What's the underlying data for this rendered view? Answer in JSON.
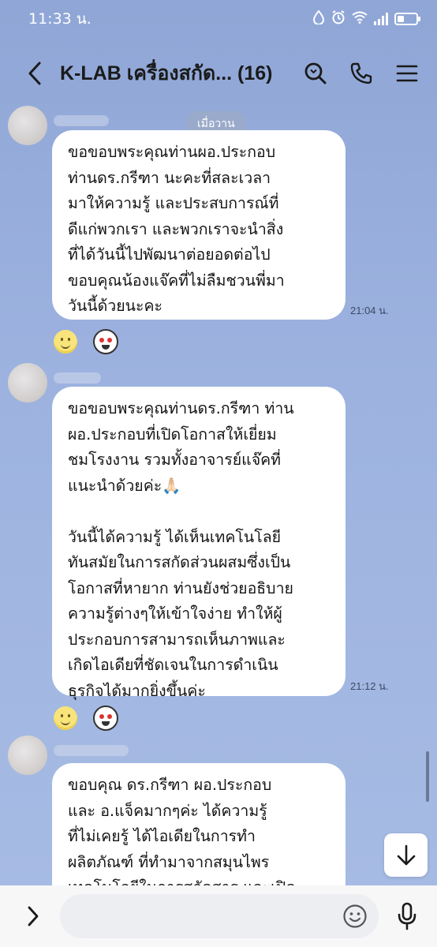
{
  "status_bar": {
    "time": "11:33 น.",
    "icons": [
      "data-saver-icon",
      "alarm-icon",
      "wifi-icon",
      "signal-icon",
      "battery-icon"
    ]
  },
  "header": {
    "title": "K-LAB  เครื่องสกัด... (16)",
    "icons": [
      "back-arrow-icon",
      "search-icon",
      "phone-icon",
      "menu-icon"
    ]
  },
  "date_separator": "เมื่อวาน",
  "messages": [
    {
      "text": "ขอขอบพระคุณท่านผอ.ประกอบ\nท่านดร.กรีฑา นะคะที่สละเวลา\nมาให้ความรู้ และประสบการณ์ที่\nดีแก่พวกเรา และพวกเราจะนำสิ่ง\nที่ได้วันนี้ไปพัฒนาต่อยอดต่อไป\nขอบคุณน้องแจ๊คที่ไม่ลืมชวนพี่มา\nวันนี้ด้วยนะคะ",
      "time": "21:04 น.",
      "reactions": [
        "smile-reaction-icon",
        "sticker-reaction-icon"
      ]
    },
    {
      "text": "ขอขอบพระคุณท่านดร.กรีฑา ท่าน\nผอ.ประกอบที่เปิดโอกาสให้เยี่ยม\nชมโรงงาน รวมทั้งอาจารย์แจ๊คที่\nแนะนำด้วยค่ะ🙏🏻\n\nวันนี้ได้ความรู้ ได้เห็นเทคโนโลยี\nทันสมัยในการสกัดส่วนผสมซึ่งเป็น\nโอกาสที่หายาก ท่านยังช่วยอธิบาย\nความรู้ต่างๆให้เข้าใจง่าย ทำให้ผู้\nประกอบการสามารถเห็นภาพและ\nเกิดไอเดียที่ชัดเจนในการดำเนิน\nธุรกิจได้มากยิ่งขึ้นค่ะ",
      "time": "21:12 น.",
      "reactions": [
        "smile-reaction-icon",
        "heart-eyes-reaction-icon"
      ]
    },
    {
      "text": "ขอบคุณ ดร.กรีฑา ผอ.ประกอบ\nและ อ.แจ็คมากๆค่ะ ได้ความรู้\nที่ไม่เคยรู้ ได้ไอเดียในการทำ\nผลิตภัณฑ์ ที่ทำมาจากสมุนไพร\nเทคโนโลยีในการสกัดสาร และเปิด"
    }
  ],
  "input_bar": {
    "value": "",
    "icons": [
      "expand-chevron-icon",
      "emoji-icon",
      "microphone-icon"
    ]
  },
  "colors": {
    "background": "#9db2df",
    "bubble": "#ffffff",
    "input_bar": "#f7f7f8"
  }
}
